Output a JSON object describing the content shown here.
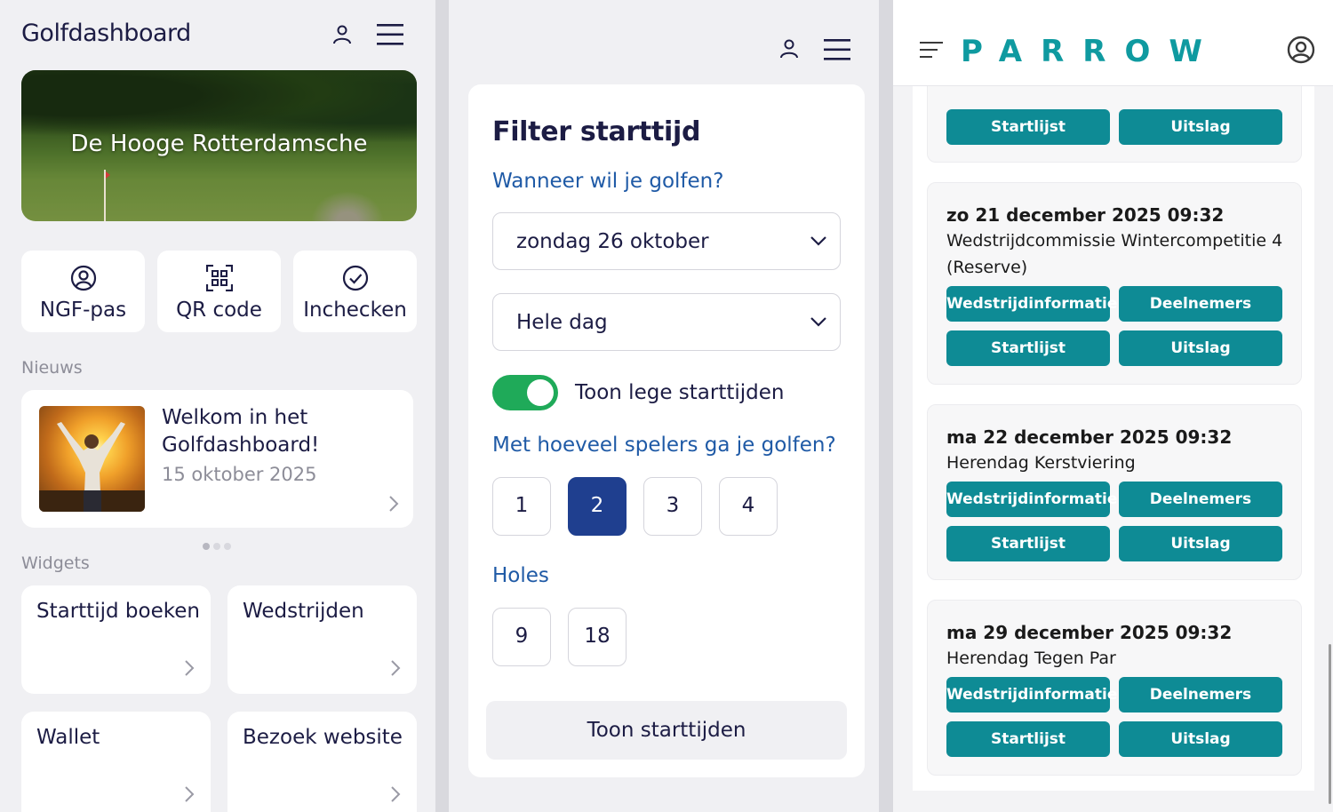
{
  "panel1": {
    "title": "Golfdashboard",
    "hero_title": "De Hooge Rotterdamsche",
    "quick_actions": [
      {
        "label": "NGF-pas",
        "icon": "user-circle-icon"
      },
      {
        "label": "QR code",
        "icon": "qr-code-icon"
      },
      {
        "label": "Inchecken",
        "icon": "check-circle-icon"
      }
    ],
    "news_label": "Nieuws",
    "news": {
      "title": "Welkom in het Golfdashboard!",
      "date": "15 oktober 2025"
    },
    "widgets_label": "Widgets",
    "widgets": [
      "Starttijd boeken",
      "Wedstrijden",
      "Wallet",
      "Bezoek website"
    ]
  },
  "panel2": {
    "title": "Filter starttijd",
    "q_when": "Wanneer wil je golfen?",
    "date_select": "zondag 26 oktober",
    "time_select": "Hele dag",
    "toggle_label": "Toon lege starttijden",
    "toggle_on": true,
    "q_players": "Met hoeveel spelers ga je golfen?",
    "players": [
      "1",
      "2",
      "3",
      "4"
    ],
    "players_selected": "2",
    "holes_label": "Holes",
    "holes": [
      "9",
      "18"
    ],
    "show_button": "Toon starttijden"
  },
  "panel3": {
    "logo": "PARROW",
    "buttons": {
      "info": "Wedstrijdinformatie",
      "participants": "Deelnemers",
      "startlist": "Startlijst",
      "result": "Uitslag"
    },
    "events": [
      {
        "date": "zo 21 december 2025 09:32",
        "name": "Wedstrijdcommissie Wintercompetitie 4 (Reserve)"
      },
      {
        "date": "ma 22 december 2025 09:32",
        "name": "Herendag Kerstviering"
      },
      {
        "date": "ma 29 december 2025 09:32",
        "name": "Herendag Tegen Par"
      }
    ]
  },
  "colors": {
    "navy": "#1c1c44",
    "blue_text": "#1f5aa6",
    "selected_blue": "#1f3f8f",
    "toggle_green": "#1faa59",
    "teal": "#0e8b95"
  }
}
